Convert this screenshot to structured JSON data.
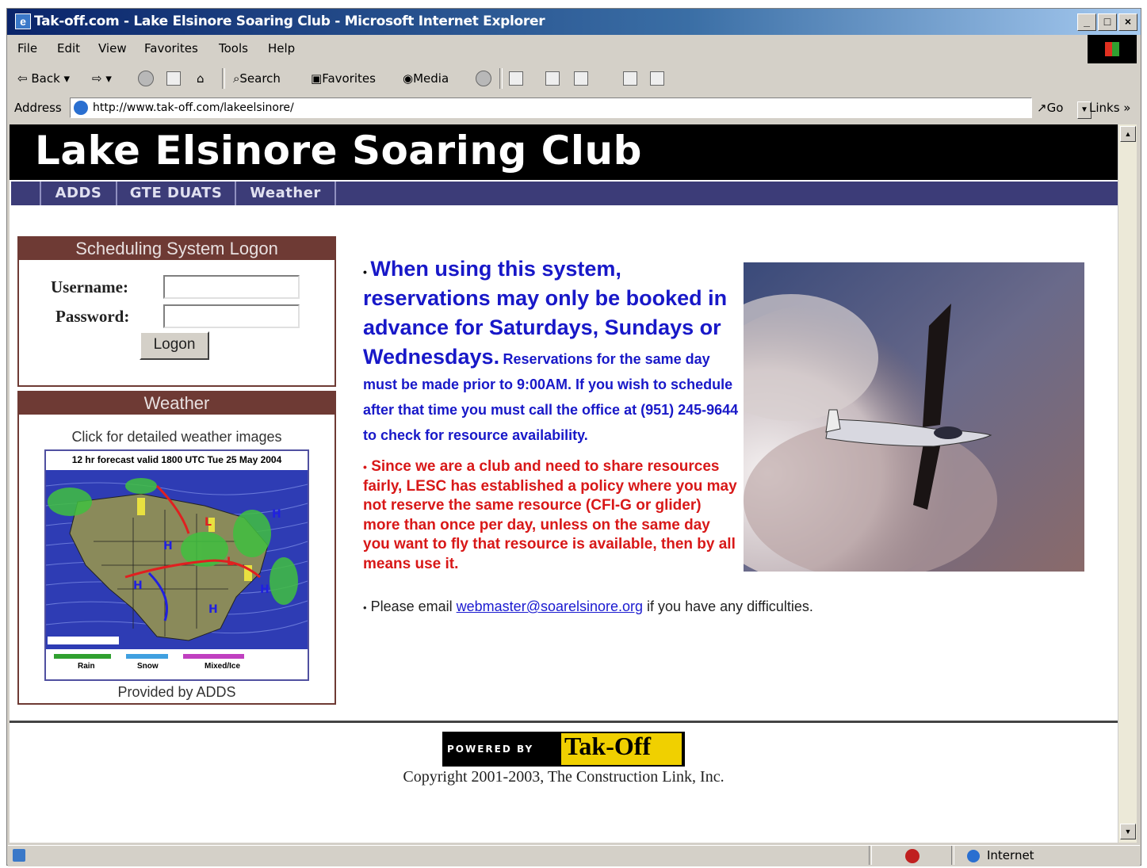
{
  "window": {
    "title": "Tak-off.com - Lake Elsinore Soaring Club - Microsoft Internet Explorer",
    "minimize": "_",
    "maximize": "□",
    "close": "×"
  },
  "menu": [
    "File",
    "Edit",
    "View",
    "Favorites",
    "Tools",
    "Help"
  ],
  "toolbar": {
    "back": "Back",
    "search": "Search",
    "favorites": "Favorites",
    "media": "Media"
  },
  "address": {
    "label": "Address",
    "url": "http://www.tak-off.com/lakeelsinore/",
    "go": "Go",
    "links": "Links »"
  },
  "page": {
    "title": "Lake Elsinore Soaring Club",
    "nav": [
      "ADDS",
      "GTE DUATS",
      "Weather"
    ],
    "logon": {
      "heading": "Scheduling System Logon",
      "username_label": "Username:",
      "password_label": "Password:",
      "username_value": "",
      "password_value": "",
      "button": "Logon"
    },
    "weather": {
      "heading": "Weather",
      "caption": "Click for detailed weather images",
      "map_title": "12 hr forecast valid 1800 UTC Tue 25 May 2004",
      "map_legend": [
        "Rain",
        "Snow",
        "Mixed/Ice"
      ],
      "provided_by": "Provided by ADDS"
    },
    "notice1_big": "When using this system, reservations may only be booked in advance for Saturdays, Sundays or Wednesdays.",
    "notice1_small": "Reservations for the same day must be made prior to 9:00AM. If you wish to schedule after that time you must call the office at (951) 245-9644 to check for resource availability.",
    "notice2": "Since we are a club and need to share resources fairly, LESC has established a policy where you may not reserve the same resource (CFI-G or glider) more than once per day, unless on the same day you want to fly that resource is available, then by all means use it.",
    "notice3_pre": "Please email",
    "notice3_link": "webmaster@soarelsinore.org",
    "notice3_post": "if you have any difficulties.",
    "powered_by": "POWERED BY",
    "powered_brand": "Tak-Off",
    "copyright": "Copyright 2001-2003, The Construction Link, Inc."
  },
  "status": {
    "zone": "Internet"
  }
}
